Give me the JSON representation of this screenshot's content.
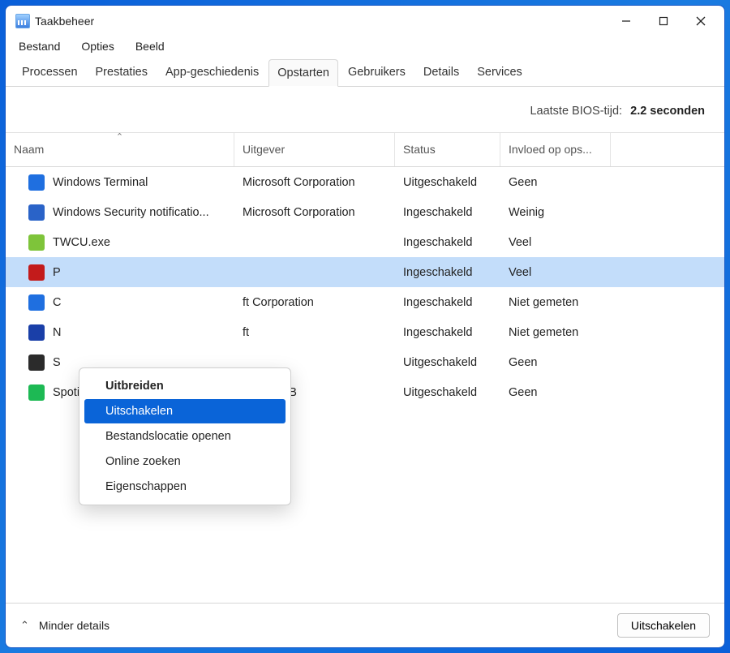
{
  "window": {
    "title": "Taakbeheer"
  },
  "menubar": [
    "Bestand",
    "Opties",
    "Beeld"
  ],
  "tabs": {
    "items": [
      "Processen",
      "Prestaties",
      "App-geschiedenis",
      "Opstarten",
      "Gebruikers",
      "Details",
      "Services"
    ],
    "active_index": 3
  },
  "bios": {
    "label": "Laatste BIOS-tijd:",
    "value": "2.2 seconden"
  },
  "columns": {
    "name": "Naam",
    "publisher": "Uitgever",
    "status": "Status",
    "impact": "Invloed op ops..."
  },
  "rows": [
    {
      "name": "Windows Terminal",
      "publisher": "Microsoft Corporation",
      "status": "Uitgeschakeld",
      "impact": "Geen",
      "icon_color": "#1f6fe0",
      "selected": false
    },
    {
      "name": "Windows Security notificatio...",
      "publisher": "Microsoft Corporation",
      "status": "Ingeschakeld",
      "impact": "Weinig",
      "icon_color": "#2a63c8",
      "selected": false
    },
    {
      "name": "TWCU.exe",
      "publisher": "",
      "status": "Ingeschakeld",
      "impact": "Veel",
      "icon_color": "#7ec43a",
      "selected": false
    },
    {
      "name": "P",
      "publisher": "",
      "status": "Ingeschakeld",
      "impact": "Veel",
      "icon_color": "#c31b1b",
      "selected": true
    },
    {
      "name": "C",
      "publisher": "ft Corporation",
      "status": "Ingeschakeld",
      "impact": "Niet gemeten",
      "icon_color": "#1f6fe0",
      "selected": false
    },
    {
      "name": "N",
      "publisher": "ft",
      "status": "Ingeschakeld",
      "impact": "Niet gemeten",
      "icon_color": "#1a3fa8",
      "selected": false
    },
    {
      "name": "S",
      "publisher": "",
      "status": "Uitgeschakeld",
      "impact": "Geen",
      "icon_color": "#2b2b2b",
      "selected": false
    },
    {
      "name": "Spotify",
      "publisher": "Spotify AB",
      "status": "Uitgeschakeld",
      "impact": "Geen",
      "icon_color": "#1db954",
      "selected": false
    }
  ],
  "context_menu": {
    "items": [
      {
        "label": "Uitbreiden",
        "bold": true,
        "hover": false
      },
      {
        "label": "Uitschakelen",
        "bold": false,
        "hover": true
      },
      {
        "label": "Bestandslocatie openen",
        "bold": false,
        "hover": false
      },
      {
        "label": "Online zoeken",
        "bold": false,
        "hover": false
      },
      {
        "label": "Eigenschappen",
        "bold": false,
        "hover": false
      }
    ]
  },
  "footer": {
    "fewer_details": "Minder details",
    "disable_button": "Uitschakelen"
  }
}
